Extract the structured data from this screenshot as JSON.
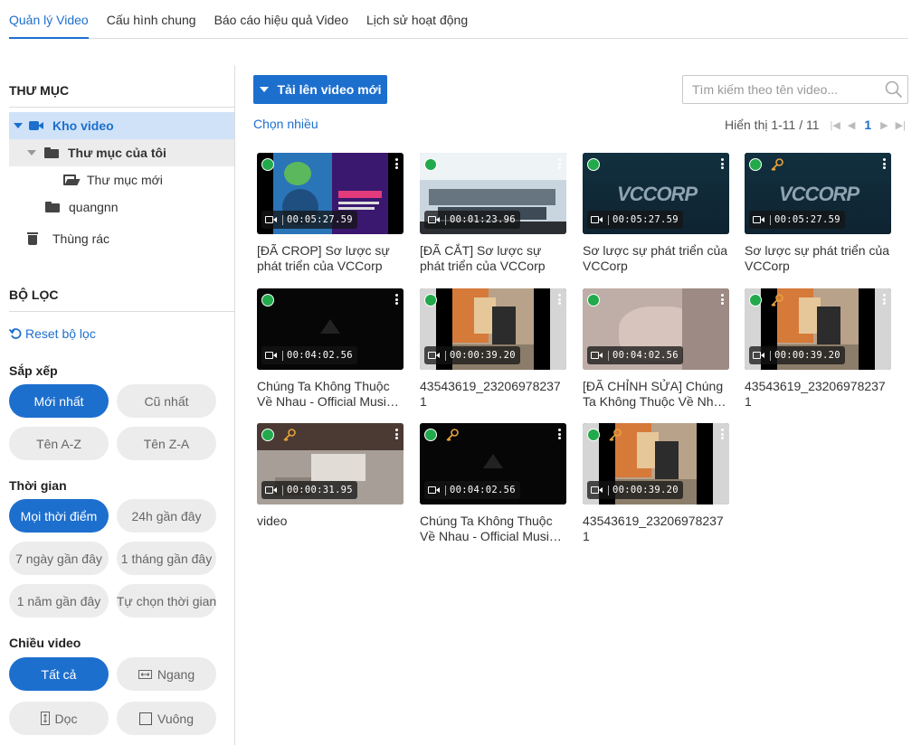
{
  "tabs": [
    {
      "label": "Quản lý Video",
      "active": true
    },
    {
      "label": "Cấu hình chung",
      "active": false
    },
    {
      "label": "Báo cáo hiệu quả Video",
      "active": false
    },
    {
      "label": "Lịch sử hoạt động",
      "active": false
    }
  ],
  "sidebar": {
    "folder_title": "THƯ MỤC",
    "tree": {
      "root": "Kho video",
      "my_folder": "Thư mục của tôi",
      "new_folder": "Thư mục mới",
      "user_folder": "quangnn",
      "trash": "Thùng rác"
    },
    "filter_title": "BỘ LỌC",
    "reset_label": "Reset bộ lọc",
    "sort": {
      "label": "Sắp xếp",
      "options": [
        "Mới nhất",
        "Cũ nhất",
        "Tên A-Z",
        "Tên Z-A"
      ],
      "selected": "Mới nhất"
    },
    "time": {
      "label": "Thời gian",
      "options": [
        "Mọi thời điểm",
        "24h gần đây",
        "7 ngày gần đây",
        "1 tháng gần đây",
        "1 năm gần đây",
        "Tự chọn thời gian"
      ],
      "selected": "Mọi thời điểm"
    },
    "orientation": {
      "label": "Chiều video",
      "options": [
        "Tất cả",
        "Ngang",
        "Dọc",
        "Vuông"
      ],
      "selected": "Tất cả"
    }
  },
  "toolbar": {
    "upload_label": "Tải lên video mới",
    "search_placeholder": "Tìm kiếm theo tên video...",
    "multi_select_label": "Chọn nhiều",
    "paging_text": "Hiển thị 1-11 / 11",
    "current_page": "1"
  },
  "videos": [
    {
      "title": "[ĐÃ CROP] Sơ lược sự phát triển của VCCorp",
      "duration": "00:05:27.59",
      "key": false,
      "thumb": "slides"
    },
    {
      "title": "[ĐÃ CẮT] Sơ lược sự phát triển của VCCorp",
      "duration": "00:01:23.96",
      "key": false,
      "thumb": "office"
    },
    {
      "title": "Sơ lược sự phát triển của VCCorp",
      "duration": "00:05:27.59",
      "key": false,
      "thumb": "vccorp"
    },
    {
      "title": "Sơ lược sự phát triển của VCCorp",
      "duration": "00:05:27.59",
      "key": true,
      "thumb": "vccorp"
    },
    {
      "title": "Chúng Ta Không Thuộc Về Nhau - Official Music Video",
      "duration": "00:04:02.56",
      "key": false,
      "thumb": "dark"
    },
    {
      "title": "43543619_232069782371",
      "duration": "00:00:39.20",
      "key": false,
      "thumb": "shop"
    },
    {
      "title": "[ĐÃ CHỈNH SỬA] Chúng Ta Không Thuộc Về Nhau - Official Music Video",
      "duration": "00:04:02.56",
      "key": false,
      "thumb": "closeup"
    },
    {
      "title": "43543619_232069782371",
      "duration": "00:00:39.20",
      "key": true,
      "thumb": "shop"
    },
    {
      "title": "video",
      "duration": "00:00:31.95",
      "key": true,
      "thumb": "rooftop"
    },
    {
      "title": "Chúng Ta Không Thuộc Về Nhau - Official Music Video",
      "duration": "00:04:02.56",
      "key": true,
      "thumb": "dark"
    },
    {
      "title": "43543619_232069782371",
      "duration": "00:00:39.20",
      "key": true,
      "thumb": "shop"
    }
  ],
  "colors": {
    "accent": "#1d6fce",
    "status_dot": "#22a94b",
    "key_icon": "#e8a23a"
  }
}
